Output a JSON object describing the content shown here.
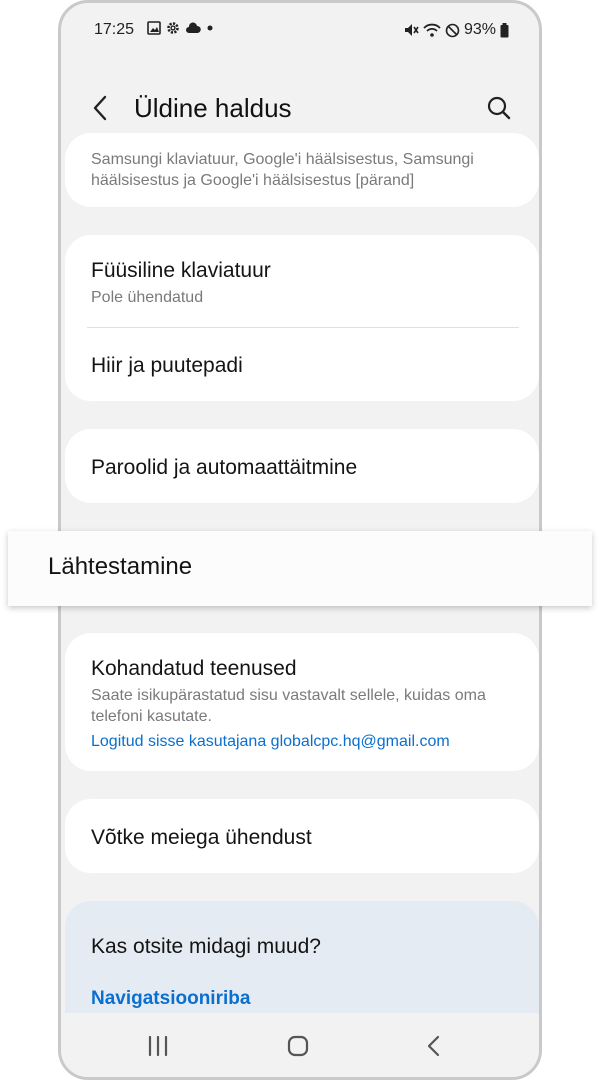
{
  "status_bar": {
    "time": "17:25",
    "battery": "93%"
  },
  "app_bar": {
    "title": "Üldine haldus"
  },
  "input_card": {
    "subtitle": "Samsungi klaviatuur, Google'i häälsisestus, Samsungi häälsisestus ja Google'i häälsisestus [pärand]"
  },
  "keyboard_card": {
    "physical_title": "Füüsiline klaviatuur",
    "physical_sub": "Pole ühendatud",
    "mouse_title": "Hiir ja puutepadi"
  },
  "passwords": {
    "title": "Paroolid ja automaattäitmine"
  },
  "reset": {
    "title": "Lähtestamine"
  },
  "custom_services": {
    "title": "Kohandatud teenused",
    "subtitle": "Saate isikupärastatud sisu vastavalt sellele, kuidas oma telefoni kasutate.",
    "link": "Logitud sisse kasutajana globalcpc.hq@gmail.com"
  },
  "contact": {
    "title": "Võtke meiega ühendust"
  },
  "suggestions": {
    "heading": "Kas otsite midagi muud?",
    "link": "Navigatsiooniriba"
  },
  "icons": {
    "back": "chevron-left-icon",
    "search": "search-icon",
    "nav_recent": "recent-apps-icon",
    "nav_home": "home-icon",
    "nav_back": "back-icon"
  },
  "colors": {
    "link": "#0a6fcf",
    "suggestion_bg": "#e4ebf3",
    "screen_bg": "#f2f2f2"
  }
}
